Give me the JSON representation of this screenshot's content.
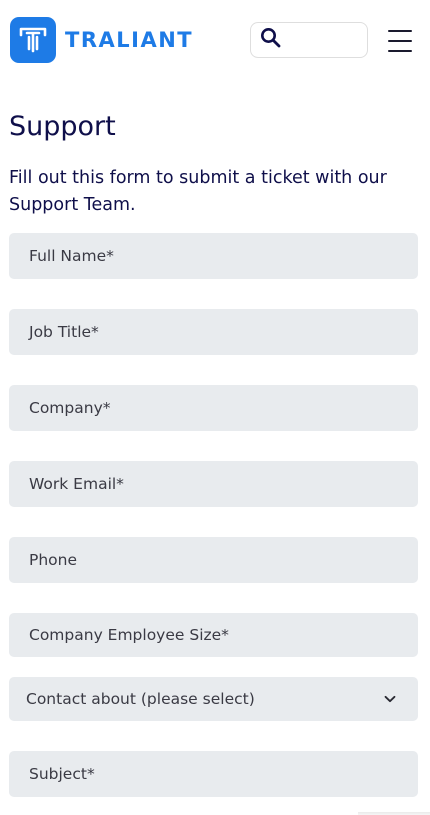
{
  "header": {
    "brand": "TRALIANT",
    "search_placeholder": ""
  },
  "page": {
    "title": "Support",
    "intro": "Fill out this form to submit a ticket with our Support Team."
  },
  "form": {
    "fields": [
      {
        "label": "Full Name*"
      },
      {
        "label": "Job Title*"
      },
      {
        "label": "Company*"
      },
      {
        "label": "Work Email*"
      },
      {
        "label": "Phone"
      },
      {
        "label": "Company Employee Size*"
      },
      {
        "label": "Contact about (please select)"
      },
      {
        "label": "Subject*"
      }
    ]
  },
  "colors": {
    "brand": "#1e7be6",
    "heading": "#0f0f4a",
    "field_bg": "#e8ebee"
  },
  "icons": [
    "traliant-logo-icon",
    "search-icon",
    "hamburger-menu-icon",
    "chevron-down-icon"
  ]
}
